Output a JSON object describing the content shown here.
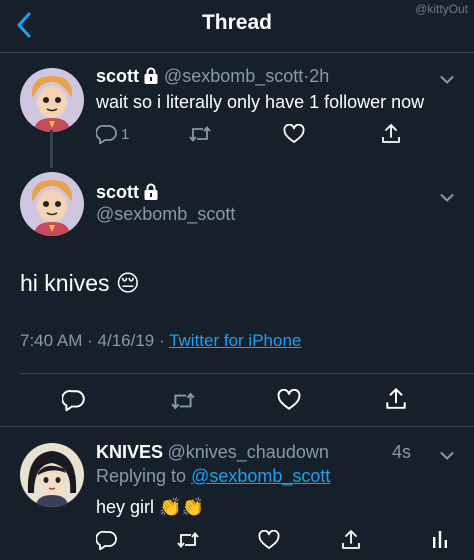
{
  "header": {
    "title": "Thread",
    "watermark": "@kittyOut"
  },
  "parent_tweet": {
    "name": "scott",
    "handle": "@sexbomb_scott",
    "separator": "·",
    "time": "2h",
    "text": "wait so i literally only have 1 follower now",
    "reply_count": "1"
  },
  "main_tweet": {
    "name": "scott",
    "handle": "@sexbomb_scott",
    "text": "hi knives",
    "emoji": "😔",
    "time": "7:40 AM",
    "dot1": "·",
    "date": "4/16/19",
    "dot2": "·",
    "source": "Twitter for iPhone"
  },
  "reply_tweet": {
    "name": "KNIVES",
    "handle": "@knives_chaudown",
    "time": "4s",
    "replying_prefix": "Replying to",
    "replying_to": "@sexbomb_scott",
    "text": "hey girl",
    "emoji": "👏👏"
  },
  "colors": {
    "background": "#15202b",
    "accent": "#1da1f2",
    "secondary_text": "#8899a6",
    "divider": "#38444d"
  },
  "icons": [
    "back-chevron-icon",
    "lock-icon",
    "chevron-down-icon",
    "reply-icon",
    "retweet-icon",
    "like-icon",
    "share-icon",
    "analytics-icon"
  ]
}
